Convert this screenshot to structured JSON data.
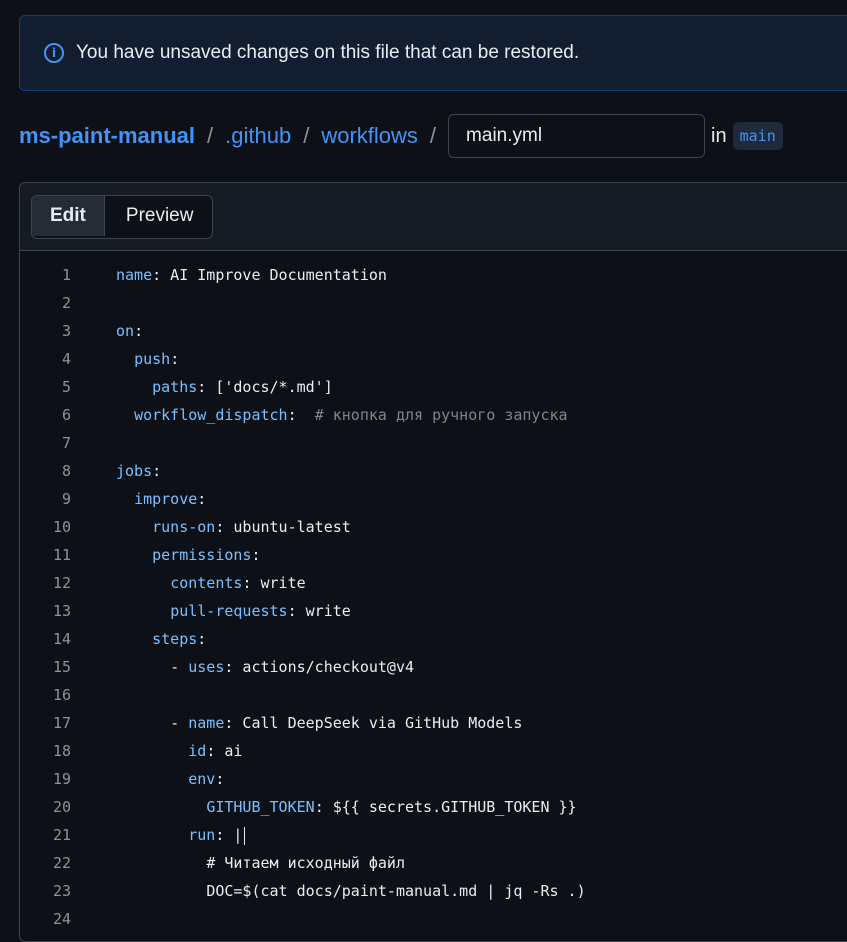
{
  "banner": {
    "icon": "info-icon",
    "text": "You have unsaved changes on this file that can be restored."
  },
  "breadcrumb": {
    "repo": "ms-paint-manual",
    "dir1": ".github",
    "dir2": "workflows",
    "separator": "/",
    "filename": "main.yml",
    "in_label": "in",
    "branch": "main"
  },
  "tabs": {
    "edit": "Edit",
    "preview": "Preview"
  },
  "code": {
    "lines": [
      {
        "n": "1",
        "indent": "",
        "key": "name",
        "rest": ": AI Improve Documentation"
      },
      {
        "n": "2",
        "indent": "",
        "key": "",
        "rest": ""
      },
      {
        "n": "3",
        "indent": "",
        "key": "on",
        "rest": ":"
      },
      {
        "n": "4",
        "indent": "  ",
        "key": "push",
        "rest": ":"
      },
      {
        "n": "5",
        "indent": "    ",
        "key": "paths",
        "rest": ": ['docs/*.md']"
      },
      {
        "n": "6",
        "indent": "  ",
        "key": "workflow_dispatch",
        "rest": ":  ",
        "comment": "# кнопка для ручного запуска"
      },
      {
        "n": "7",
        "indent": "",
        "key": "",
        "rest": ""
      },
      {
        "n": "8",
        "indent": "",
        "key": "jobs",
        "rest": ":"
      },
      {
        "n": "9",
        "indent": "  ",
        "key": "improve",
        "rest": ":"
      },
      {
        "n": "10",
        "indent": "    ",
        "key": "runs-on",
        "rest": ": ubuntu-latest"
      },
      {
        "n": "11",
        "indent": "    ",
        "key": "permissions",
        "rest": ":"
      },
      {
        "n": "12",
        "indent": "      ",
        "key": "contents",
        "rest": ": write"
      },
      {
        "n": "13",
        "indent": "      ",
        "key": "pull-requests",
        "rest": ": write"
      },
      {
        "n": "14",
        "indent": "    ",
        "key": "steps",
        "rest": ":"
      },
      {
        "n": "15",
        "indent": "      - ",
        "key": "uses",
        "rest": ": actions/checkout@v4"
      },
      {
        "n": "16",
        "indent": "",
        "key": "",
        "rest": ""
      },
      {
        "n": "17",
        "indent": "      - ",
        "key": "name",
        "rest": ": Call DeepSeek via GitHub Models"
      },
      {
        "n": "18",
        "indent": "        ",
        "key": "id",
        "rest": ": ai"
      },
      {
        "n": "19",
        "indent": "        ",
        "key": "env",
        "rest": ":"
      },
      {
        "n": "20",
        "indent": "          ",
        "key": "GITHUB_TOKEN",
        "rest": ": ${{ secrets.GITHUB_TOKEN }}"
      },
      {
        "n": "21",
        "indent": "        ",
        "key": "run",
        "rest": ": |",
        "cursor": true
      },
      {
        "n": "22",
        "indent": "          ",
        "key": "",
        "rest": "# Читаем исходный файл"
      },
      {
        "n": "23",
        "indent": "          ",
        "key": "",
        "rest": "DOC=$(cat docs/paint-manual.md | jq -Rs .)"
      },
      {
        "n": "24",
        "indent": "",
        "key": "",
        "rest": ""
      }
    ]
  },
  "colors": {
    "background": "#0d1117",
    "accent": "#4493f8",
    "key": "#79c0ff",
    "comment": "#7d8590"
  }
}
